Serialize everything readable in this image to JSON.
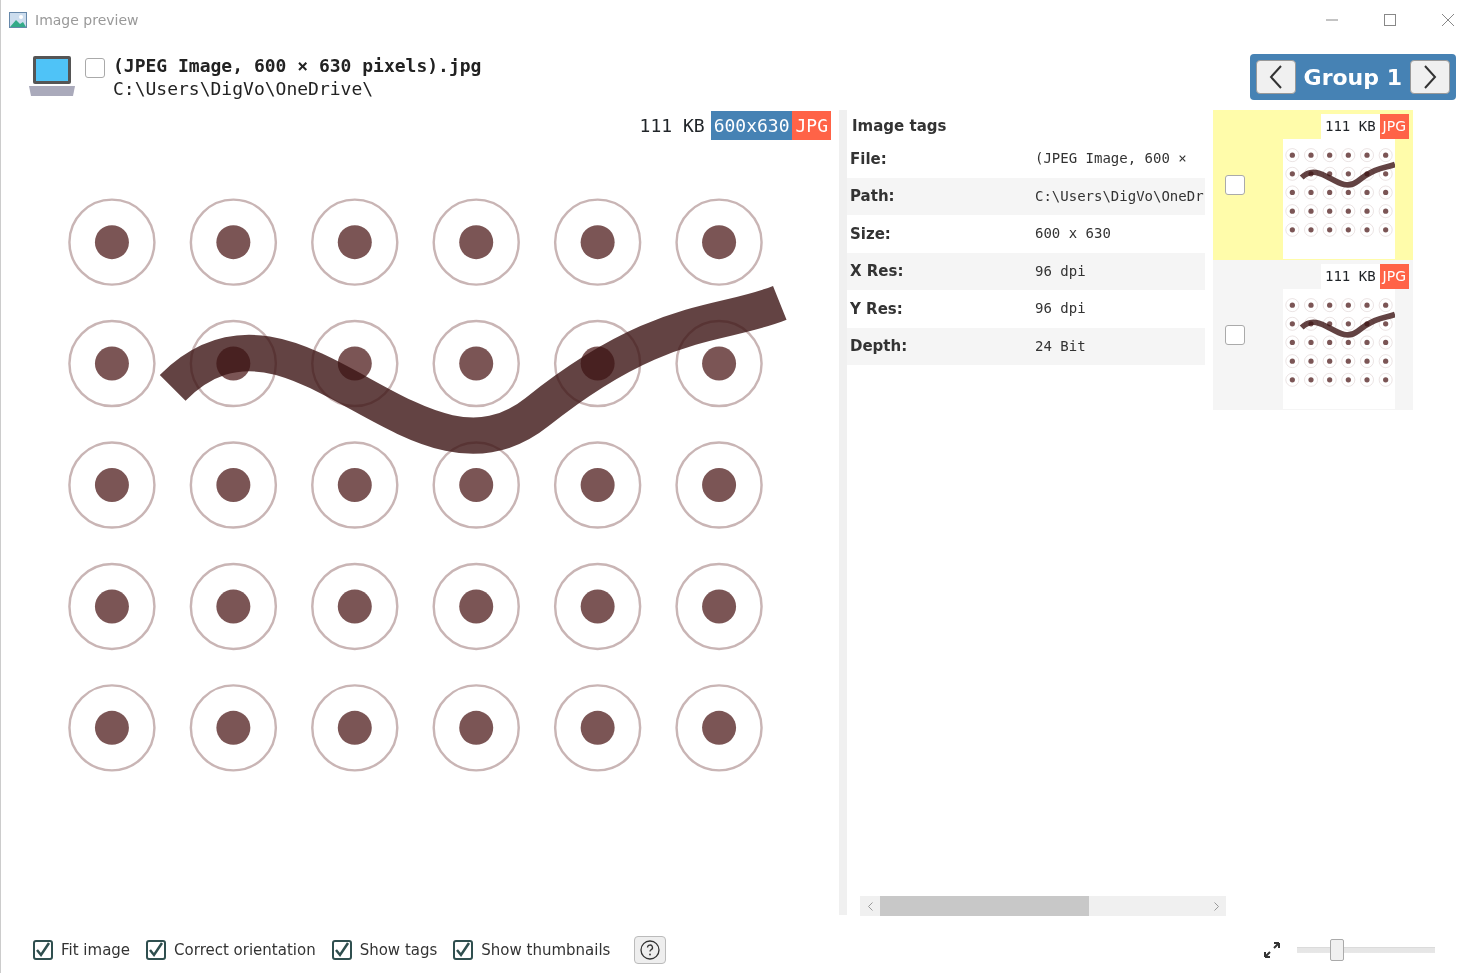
{
  "window": {
    "title": "Image preview"
  },
  "header": {
    "checked": false,
    "file_name": "(JPEG Image, 600 × 630 pixels).jpg",
    "path": "C:\\Users\\DigVo\\OneDrive\\"
  },
  "group_nav": {
    "label": "Group 1"
  },
  "preview": {
    "size": "111 KB",
    "dimensions": "600x630",
    "type": "JPG"
  },
  "tags": {
    "heading": "Image tags",
    "rows": [
      {
        "label": "File:",
        "value": "(JPEG Image, 600 ×"
      },
      {
        "label": "Path:",
        "value": "C:\\Users\\DigVo\\OneDr"
      },
      {
        "label": "Size:",
        "value": "600 x 630"
      },
      {
        "label": "X Res:",
        "value": "96 dpi"
      },
      {
        "label": "Y Res:",
        "value": "96 dpi"
      },
      {
        "label": "Depth:",
        "value": "24 Bit"
      }
    ]
  },
  "thumbnails": [
    {
      "size": "111 KB",
      "type": "JPG",
      "selected": true,
      "checked": false
    },
    {
      "size": "111 KB",
      "type": "JPG",
      "selected": false,
      "checked": false
    }
  ],
  "options": [
    {
      "label": "Fit image",
      "checked": true
    },
    {
      "label": "Correct orientation",
      "checked": true
    },
    {
      "label": "Show tags",
      "checked": true
    },
    {
      "label": "Show thumbnails",
      "checked": true
    }
  ],
  "zoom": {
    "level": 0.29
  }
}
